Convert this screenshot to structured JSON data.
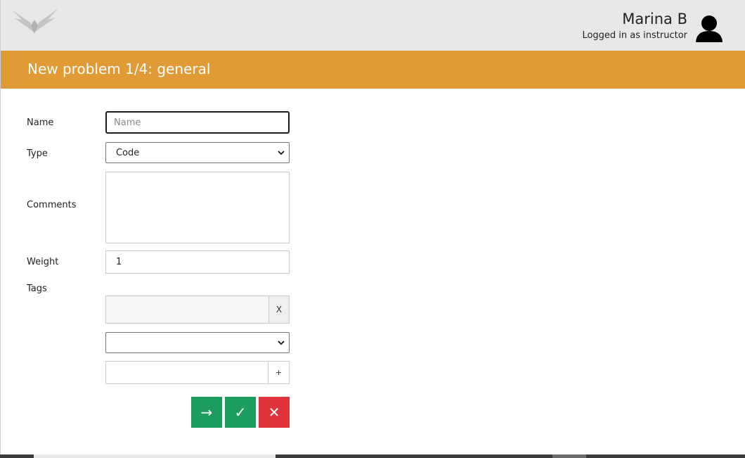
{
  "user": {
    "name": "Marina B",
    "role_text": "Logged in as instructor"
  },
  "header": {
    "title": "New problem 1/4: general"
  },
  "form": {
    "name": {
      "label": "Name",
      "placeholder": "Name",
      "value": ""
    },
    "type": {
      "label": "Type",
      "selected": "Code"
    },
    "comments": {
      "label": "Comments",
      "value": ""
    },
    "weight": {
      "label": "Weight",
      "value": "1"
    },
    "tags": {
      "label": "Tags",
      "remove_label": "X",
      "select_value": "",
      "add_label": "+"
    }
  },
  "actions": {
    "next_label": "→",
    "save_label": "✓",
    "cancel_label": "✕"
  },
  "icons": {
    "logo": "wings-logo-icon",
    "avatar": "user-avatar-icon",
    "chevron": "chevron-down-icon"
  },
  "colors": {
    "header_bg": "#e09a36",
    "topbar_bg": "#e8e8e8",
    "success": "#1e9e5e",
    "danger": "#e0323a"
  }
}
